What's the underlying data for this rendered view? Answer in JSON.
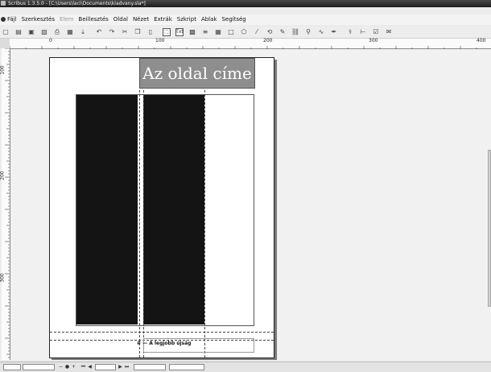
{
  "window": {
    "title": "Scribus 1.3.5.0 - [C:\\Users\\laci\\Documents\\kiadvany.sla*]"
  },
  "menu": [
    {
      "label": "Fájl",
      "enabled": true
    },
    {
      "label": "Szerkesztés",
      "enabled": true
    },
    {
      "label": "Elem",
      "enabled": false
    },
    {
      "label": "Beillesztés",
      "enabled": true
    },
    {
      "label": "Oldal",
      "enabled": true
    },
    {
      "label": "Nézet",
      "enabled": true
    },
    {
      "label": "Extrák",
      "enabled": true
    },
    {
      "label": "Szkript",
      "enabled": true
    },
    {
      "label": "Ablak",
      "enabled": true
    },
    {
      "label": "Segítség",
      "enabled": true
    }
  ],
  "toolbar": {
    "text_frame_label": "Txt",
    "icons": [
      "new-document-icon",
      "open-icon",
      "save-icon",
      "close-icon",
      "print-icon",
      "preflight-icon",
      "pdf-export-icon",
      "undo-icon",
      "redo-icon",
      "cut-icon",
      "copy-icon",
      "paste-icon",
      "select-icon",
      "text-frame-icon",
      "image-frame-icon",
      "render-frame-icon",
      "table-icon",
      "shape-icon",
      "polygon-icon",
      "line-icon",
      "rotate-icon",
      "edit-contents-icon",
      "link-frames-icon",
      "zoom-icon",
      "bezier-icon",
      "freehand-icon",
      "eyedropper-icon",
      "measure-icon",
      "pdf-field-icon",
      "pdf-annotation-icon"
    ]
  },
  "rulers": {
    "horizontal_labels": [
      "0",
      "100",
      "200",
      "300",
      "400"
    ],
    "vertical_labels": [
      "100",
      "200",
      "300"
    ]
  },
  "page": {
    "header_text": "Az oldal címe",
    "footer_text": "A legjobb újság"
  },
  "statusbar": {
    "zoom_value": "",
    "page_value": ""
  }
}
